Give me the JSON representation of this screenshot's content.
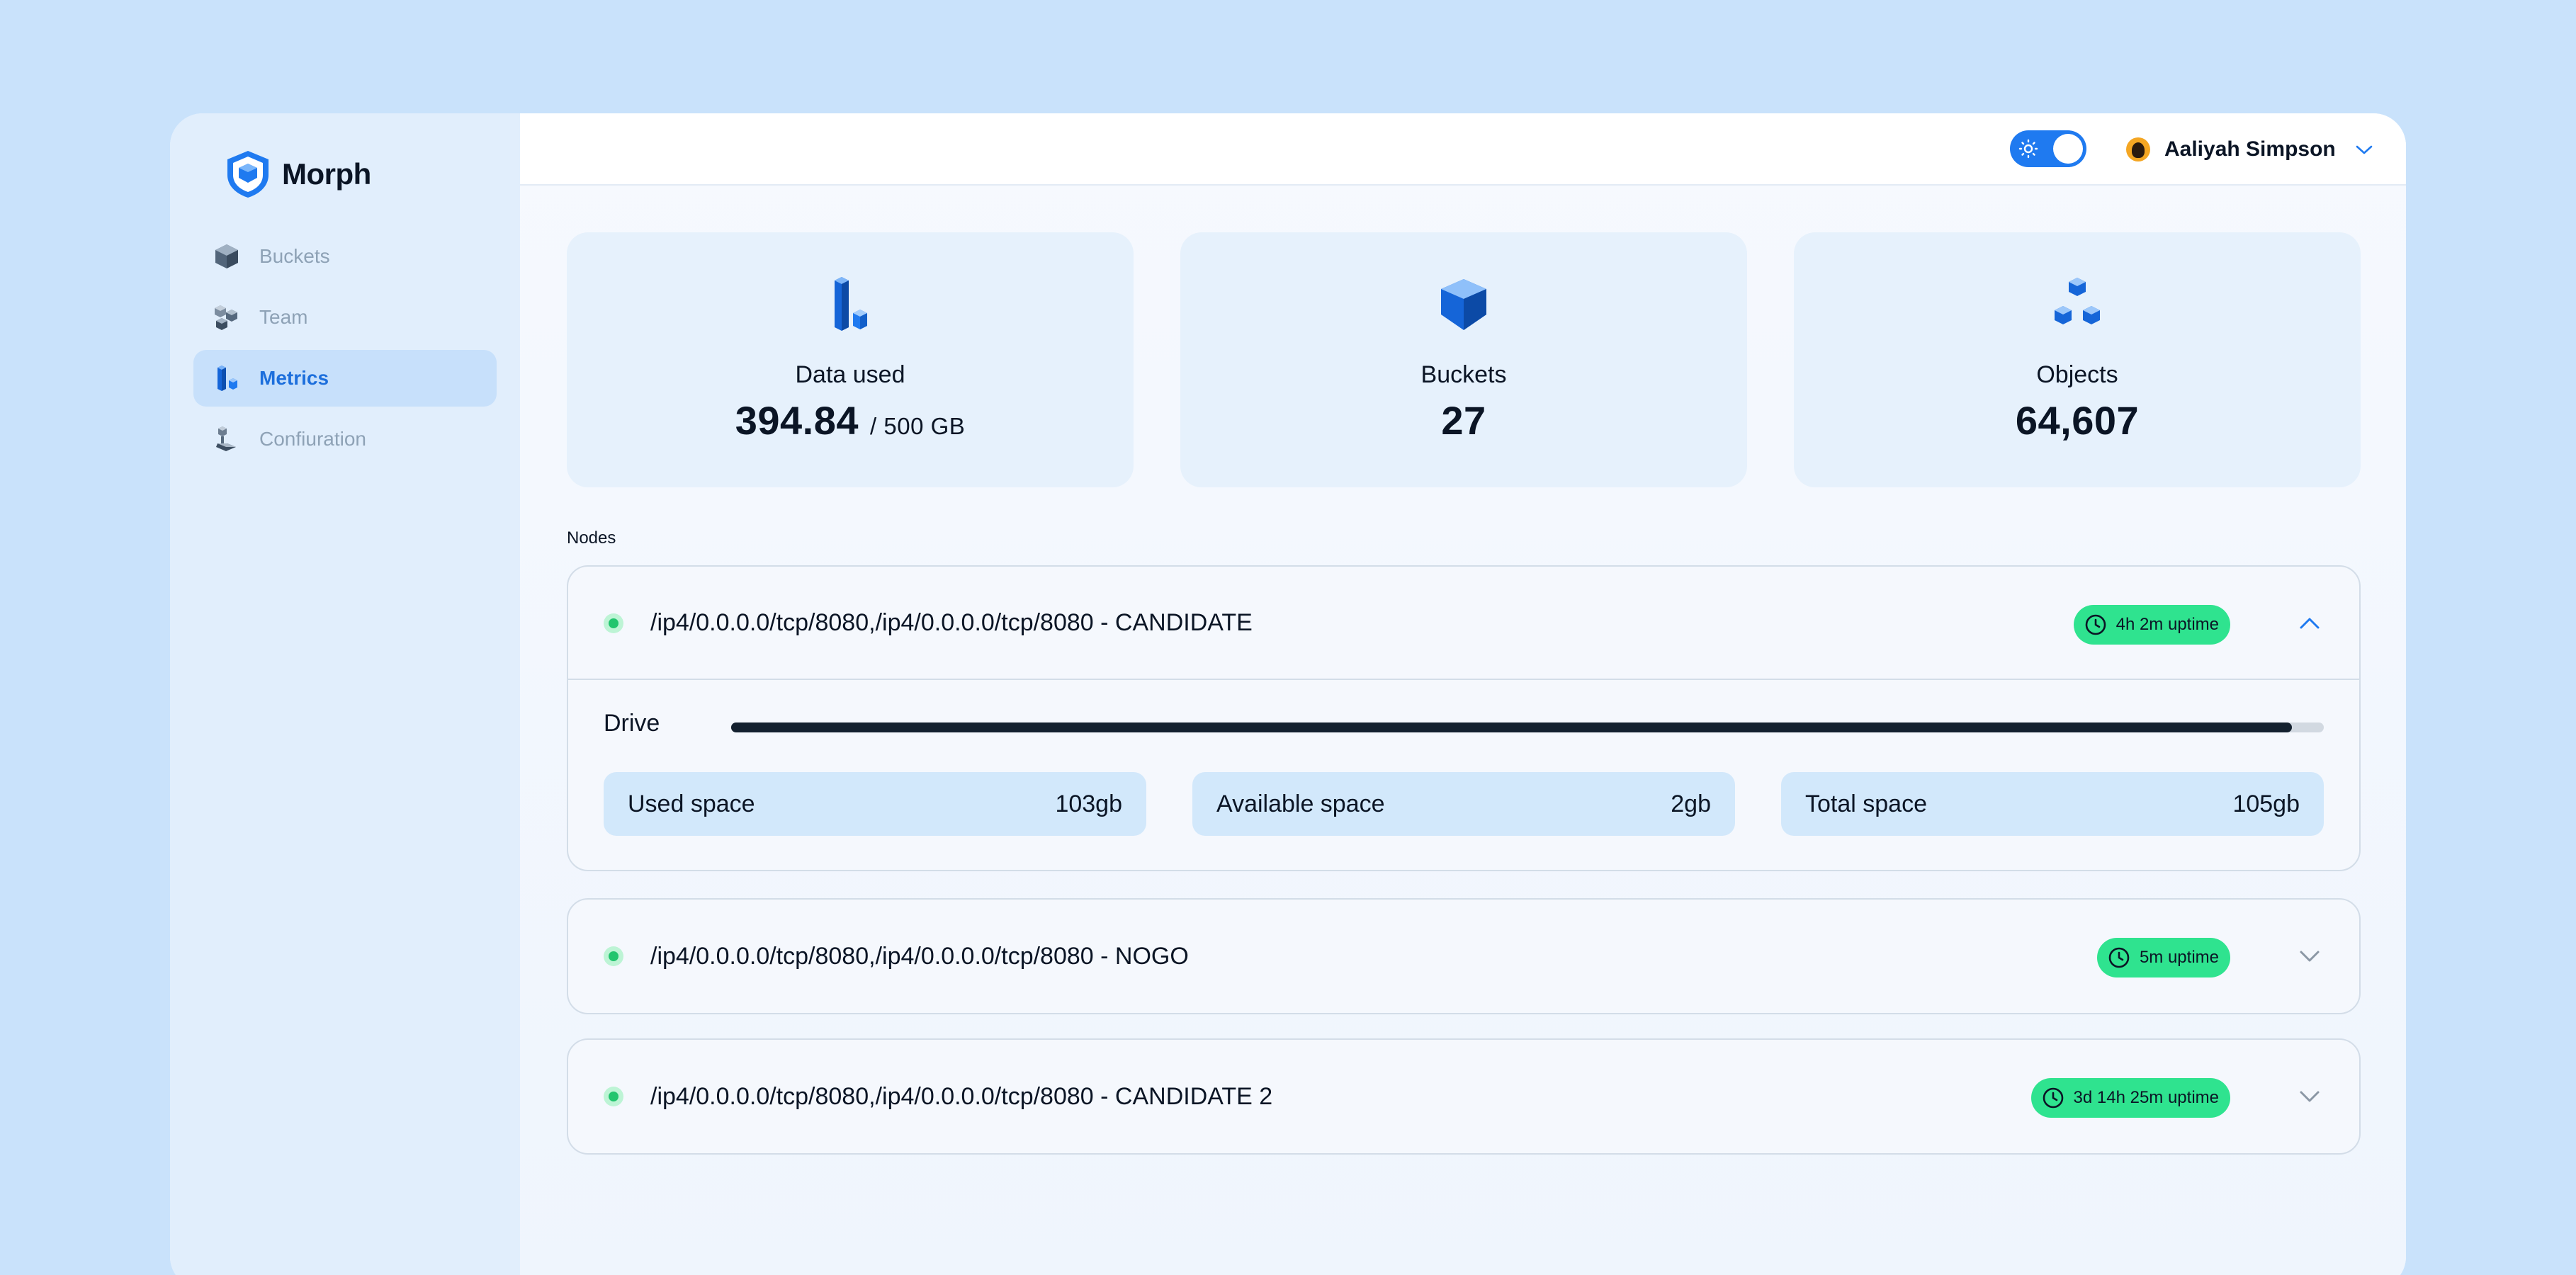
{
  "app": {
    "name": "Morph",
    "accent": "#1f7af0",
    "background": "#c9e2fb"
  },
  "sidebar": {
    "items": [
      {
        "label": "Buckets",
        "icon": "cube-icon",
        "active": false
      },
      {
        "label": "Team",
        "icon": "team-cubes-icon",
        "active": false
      },
      {
        "label": "Metrics",
        "icon": "metrics-bars-icon",
        "active": true
      },
      {
        "label": "Confiuration",
        "icon": "configuration-icon",
        "active": false
      }
    ]
  },
  "header": {
    "theme_toggle": {
      "state": "on",
      "icon": "sun-icon"
    },
    "user": {
      "name": "Aaliyah Simpson",
      "avatar": "avatar",
      "menu_icon": "chevron-down-icon"
    }
  },
  "stats": [
    {
      "label": "Data used",
      "value": "394.84",
      "unit": "/ 500 GB",
      "icon": "data-bars-icon"
    },
    {
      "label": "Buckets",
      "value": "27",
      "icon": "bucket-cube-icon"
    },
    {
      "label": "Objects",
      "value": "64,607",
      "icon": "objects-cubes-icon"
    }
  ],
  "nodes_section": {
    "title": "Nodes",
    "nodes": [
      {
        "address": "/ip4/0.0.0.0/tcp/8080,/ip4/0.0.0.0/tcp/8080 - CANDIDATE",
        "uptime": "4h 2m uptime",
        "status_color": "#22c56e",
        "expanded": true,
        "drive": {
          "label": "Drive",
          "used_fraction": 0.98,
          "used_label": "Used space",
          "used_value": "103gb",
          "available_label": "Available space",
          "available_value": "2gb",
          "total_label": "Total space",
          "total_value": "105gb"
        }
      },
      {
        "address": "/ip4/0.0.0.0/tcp/8080,/ip4/0.0.0.0/tcp/8080 - NOGO",
        "uptime": "5m uptime",
        "status_color": "#22c56e",
        "expanded": false
      },
      {
        "address": "/ip4/0.0.0.0/tcp/8080,/ip4/0.0.0.0/tcp/8080 - CANDIDATE 2",
        "uptime": "3d 14h 25m uptime",
        "status_color": "#22c56e",
        "expanded": false
      }
    ]
  }
}
